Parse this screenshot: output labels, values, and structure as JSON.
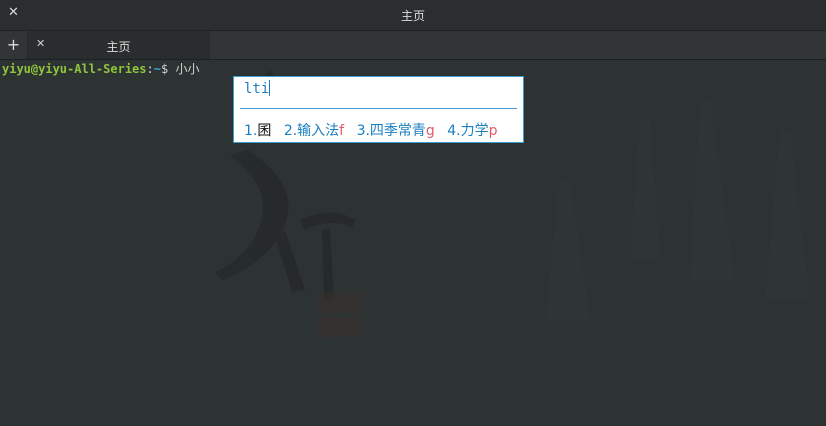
{
  "window": {
    "title": "主页"
  },
  "tabs": [
    {
      "label": "主页"
    }
  ],
  "terminal": {
    "prompt_user": "yiyu@yiyu-All-Series",
    "prompt_colon": ":",
    "prompt_path": "~",
    "prompt_symbol": "$",
    "typed": "小小"
  },
  "ime": {
    "preedit": "lti",
    "candidates": [
      {
        "index": "1.",
        "text": "囷",
        "hint": ""
      },
      {
        "index": "2.",
        "text": "输入法",
        "hint": "f"
      },
      {
        "index": "3.",
        "text": "四季常青",
        "hint": "g"
      },
      {
        "index": "4.",
        "text": "力学",
        "hint": "p"
      }
    ]
  },
  "icons": {
    "window_close": "close-icon",
    "tab_close": "close-icon",
    "new_tab": "plus-icon"
  },
  "colors": {
    "prompt_user": "#8ec43d",
    "prompt_path": "#3aa7d6",
    "ime_accent": "#1a7fc0",
    "ime_hint": "#e05a6a"
  }
}
